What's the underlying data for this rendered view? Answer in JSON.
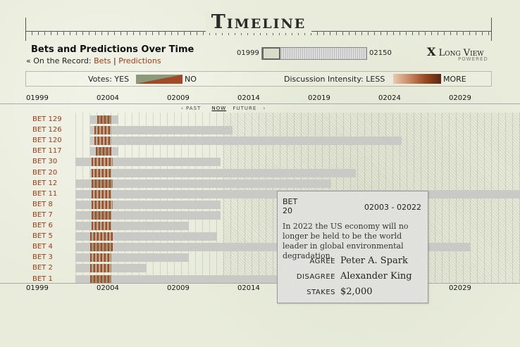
{
  "header": {
    "title": "Timeline",
    "subtitle": "Bets and Predictions Over Time",
    "record_prefix": "« On the Record:",
    "link_bets": "Bets",
    "separator": "|",
    "link_predictions": "Predictions"
  },
  "range": {
    "start": "01999",
    "end": "02150"
  },
  "brand": {
    "x": "X",
    "name": "Long View",
    "powered": "POWERED"
  },
  "legend": {
    "votes_label": "Votes: YES",
    "votes_no": "NO",
    "discussion_label": "Discussion Intensity: LESS",
    "discussion_more": "MORE"
  },
  "axis_top": [
    "01999",
    "02004",
    "02009",
    "02014",
    "02019",
    "02024",
    "02029"
  ],
  "axis_bottom": [
    "01999",
    "02004",
    "02009",
    "02014",
    "02029"
  ],
  "nav": {
    "past": "PAST",
    "now": "NOW",
    "future": "FUTURE"
  },
  "bets": [
    {
      "label": "BET 129"
    },
    {
      "label": "BET 126"
    },
    {
      "label": "BET 120"
    },
    {
      "label": "BET 117"
    },
    {
      "label": "BET 30"
    },
    {
      "label": "BET 20"
    },
    {
      "label": "BET 12"
    },
    {
      "label": "BET 11"
    },
    {
      "label": "BET 8"
    },
    {
      "label": "BET 7"
    },
    {
      "label": "BET 6"
    },
    {
      "label": "BET 5"
    },
    {
      "label": "BET 4"
    },
    {
      "label": "BET 3"
    },
    {
      "label": "BET 2"
    },
    {
      "label": "BET 1"
    }
  ],
  "popup": {
    "bet_word": "BET",
    "bet_number": "20",
    "range": "02003 - 02022",
    "description": "In 2022 the US economy will no longer be held to be the world leader in global environmental degradation.",
    "agree_label": "AGREE",
    "agree_value": "Peter A. Spark",
    "disagree_label": "DISAGREE",
    "disagree_value": "Alexander King",
    "stakes_label": "STAKES",
    "stakes_value": "$2,000"
  },
  "colors": {
    "link": "#9a3b16",
    "yes": "#8b9a7a",
    "no": "#a24a28"
  }
}
